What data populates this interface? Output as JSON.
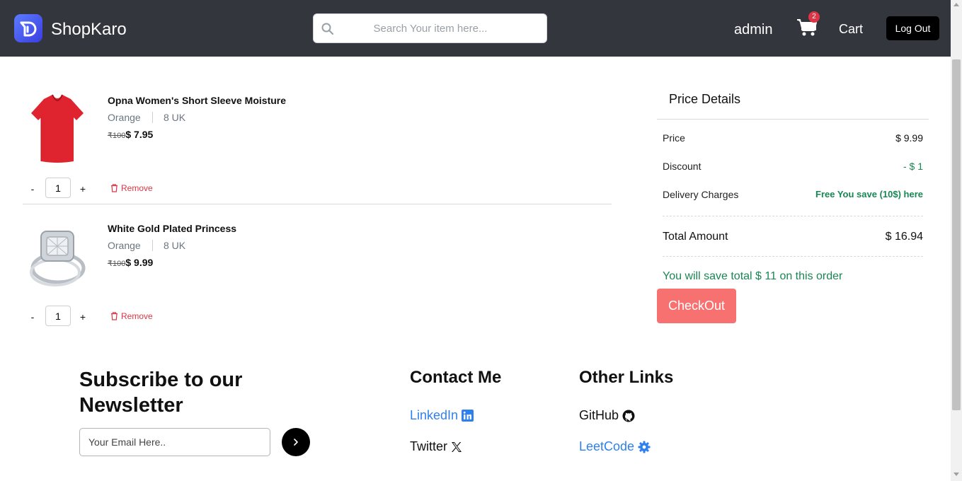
{
  "navbar": {
    "brand": "ShopKaro",
    "search_placeholder": "Search Your item here...",
    "user": "admin",
    "cart_count": "2",
    "cart_label": "Cart",
    "logout_label": "Log Out"
  },
  "cart": {
    "items": [
      {
        "name": "Opna Women's Short Sleeve Moisture",
        "color": "Orange",
        "size": "8 UK",
        "old_price": "₹100",
        "price": "$ 7.95",
        "quantity": "1",
        "remove_label": "Remove"
      },
      {
        "name": "White Gold Plated Princess",
        "color": "Orange",
        "size": "8 UK",
        "old_price": "₹100",
        "price": "$ 9.99",
        "quantity": "1",
        "remove_label": "Remove"
      }
    ],
    "minus_label": "-",
    "plus_label": "+"
  },
  "price_details": {
    "title": "Price Details",
    "rows": [
      {
        "label": "Price",
        "value": "$ 9.99"
      },
      {
        "label": "Discount",
        "value": "- $ 1"
      },
      {
        "label": "Delivery Charges",
        "value": "Free You save (10$) here"
      }
    ],
    "total_label": "Total Amount",
    "total_value": "$ 16.94",
    "save_message": "You will save total $ 11 on this order",
    "checkout_label": "CheckOut",
    "colors": {
      "green": "#198754",
      "checkout": "#f87171"
    }
  },
  "footer": {
    "newsletter_title": "Subscribe to our Newsletter",
    "email_placeholder": "Your Email Here..",
    "contact_title": "Contact Me",
    "contact_links": [
      "LinkedIn",
      "Twitter"
    ],
    "other_title": "Other Links",
    "other_links": [
      "GitHub",
      "LeetCode"
    ]
  },
  "icons": [
    "logo-icon",
    "search-icon",
    "cart-icon",
    "trash-icon",
    "linkedin-icon",
    "x-icon",
    "github-icon",
    "gear-icon",
    "chevron-right-icon"
  ]
}
